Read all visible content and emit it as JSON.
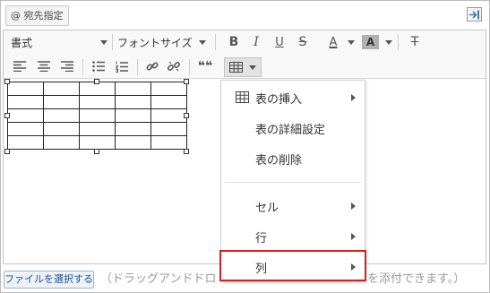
{
  "mention_button": {
    "label": "@ 宛先指定"
  },
  "toolbar": {
    "format_combo": {
      "value": "書式"
    },
    "font_size_combo": {
      "value": "フォントサイズ"
    },
    "bold_label": "B",
    "italic_label": "I",
    "underline_label": "U",
    "strike_label": "S",
    "text_color_label": "A",
    "bg_color_label": "A",
    "clear_format_label": "T",
    "blockquote_label": "❝❝",
    "colors": {
      "text_color_bar": "#d0021b",
      "bg_color_bg": "#b0b0b0"
    }
  },
  "table_menu": {
    "items": [
      {
        "label": "表の挿入",
        "submenu": true,
        "icon": "table-icon"
      },
      {
        "label": "表の詳細設定",
        "submenu": false
      },
      {
        "label": "表の削除",
        "submenu": false
      },
      {
        "label": "セル",
        "submenu": true
      },
      {
        "label": "行",
        "submenu": true
      },
      {
        "label": "列",
        "submenu": true
      }
    ],
    "highlighted_item": "列",
    "highlight_color": "#d81e1e"
  },
  "table": {
    "rows": 5,
    "cols": 5
  },
  "footer": {
    "file_button": "ファイルを選択する",
    "hint_left": "（ドラッグアンドドロ",
    "hint_right": "を添付できます。）"
  }
}
